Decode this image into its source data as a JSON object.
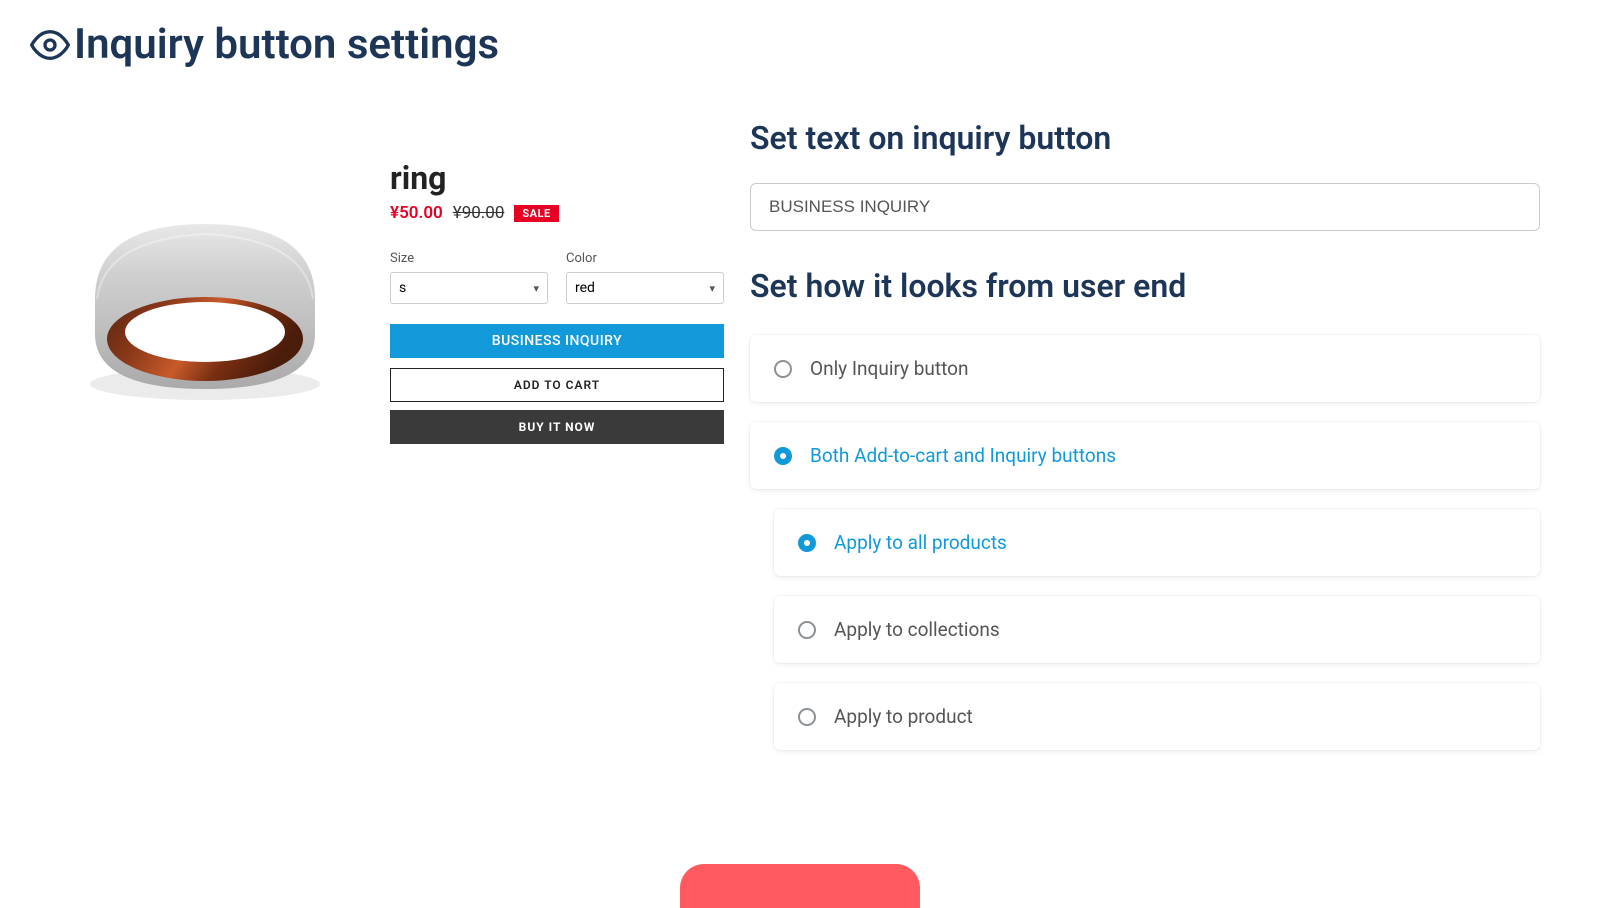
{
  "page": {
    "title": "Inquiry button settings"
  },
  "preview": {
    "product_name": "ring",
    "price": "¥50.00",
    "compare_price": "¥90.00",
    "sale_badge": "SALE",
    "variants": {
      "size_label": "Size",
      "size_value": "s",
      "color_label": "Color",
      "color_value": "red"
    },
    "buttons": {
      "inquiry": "BUSINESS INQUIRY",
      "cart": "ADD TO CART",
      "buy": "BUY IT NOW"
    }
  },
  "settings": {
    "section_text_title": "Set text on inquiry button",
    "button_text_value": "BUSINESS INQUIRY",
    "section_looks_title": "Set how it looks from user end",
    "options": {
      "only_inquiry": "Only Inquiry button",
      "both": "Both Add-to-cart and Inquiry buttons",
      "apply_all": "Apply to all products",
      "apply_collections": "Apply to collections",
      "apply_product": "Apply to product"
    }
  }
}
